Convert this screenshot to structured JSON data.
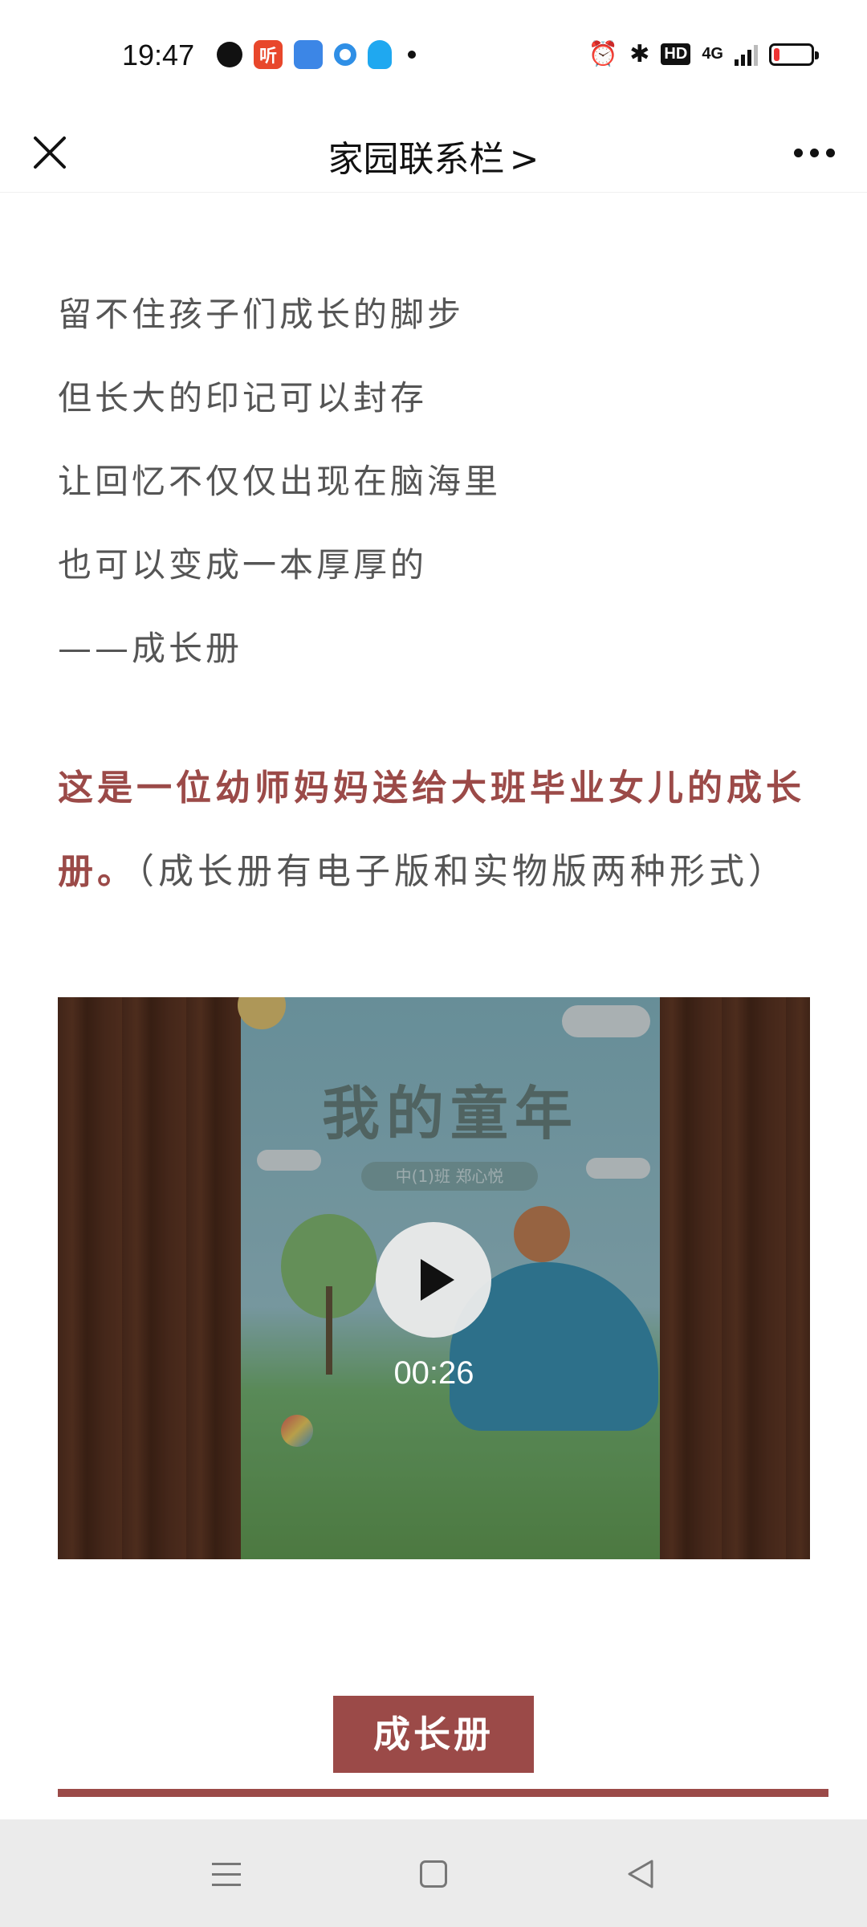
{
  "status_bar": {
    "time": "19:47",
    "app_icons": [
      "q-icon",
      "ting-icon",
      "clone-icon",
      "dot-app-icon",
      "qq-icon"
    ],
    "ting_label": "听",
    "network": "4G",
    "hd_label": "HD",
    "battery_level": 0.15
  },
  "nav": {
    "title": "家园联系栏",
    "title_chevron": ">"
  },
  "poem": {
    "lines": [
      "留不住孩子们成长的脚步",
      "但长大的印记可以封存",
      "让回忆不仅仅出现在脑海里",
      "也可以变成一本厚厚的",
      "——成长册"
    ]
  },
  "highlight": {
    "bold_text": "这是一位幼师妈妈送给大班毕业女儿的成长册。",
    "note_text": "（成长册有电子版和实物版两种形式）"
  },
  "video": {
    "book_title": "我的童年",
    "book_subtitle": "中(1)班 郑心悦",
    "duration": "00:26"
  },
  "banner": {
    "label": "成长册",
    "color": "#9b4a48"
  }
}
